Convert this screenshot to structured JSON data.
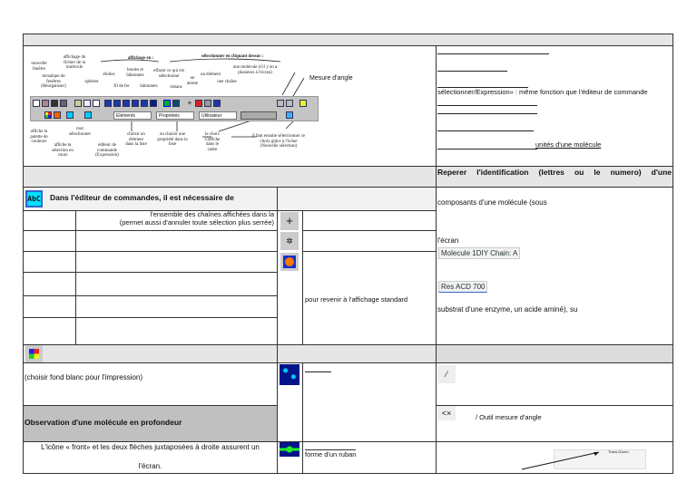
{
  "toolbar_figure": {
    "labels": {
      "nouvelle_fenetre": "nouvelle fenêtre",
      "affichage_fichier": "affichage du fichier de la molécule",
      "mosaique": "mosaïque de fenêtres (Réorganiser)",
      "affichage_en": "affichage en :",
      "spheres": "sphères",
      "stick": "étoiles",
      "fil_de_fer": "fil de fer",
      "boules_batonnets": "boules et bâtonnets",
      "batonnets": "bâtonnets",
      "effacer": "effacer ce qui est sélectionné",
      "rubans": "rubans",
      "selectionner_en_cliquant": "sélectionner en cliquant dessus :",
      "un_atome": "un atome",
      "un_element": "un élément",
      "une_chaine": "une chaîne",
      "une_molecule": "une molécule (s'il y en a plusieurs à l'écran)",
      "mesure_angle": "Mesure d'angle",
      "palette": "affiche la palette de couleurs",
      "selection_en_cours": "affiche la sélection en cours",
      "tout_selectionner": "tout sélectionner",
      "editeur_commande": "éditeur de commande (Expression)",
      "choisir_element": "choisir un élément dans la liste",
      "choisir_propriete": "ou choisir une propriété dans la liste",
      "choix_affiche": "le choix s'affiche dans le cadre",
      "il_faut_ensuite": "il faut ensuite sélectionner ce choix grâce à l'icône (Nouvelle sélection)"
    },
    "dropdowns": [
      "Eléments",
      "Propriétés",
      "Utilisateur"
    ]
  },
  "left": {
    "editor_heading": "Dans l'éditeur de commandes, il est nécessaire de",
    "row1_text_a": "l'ensemble des chaînes affichées dans la",
    "row1_text_b": "(permet aussi d'annuler toute sélection plus serrée)",
    "standard_text": "pour revenir à l'affichage standard",
    "print_text": "(choisir fond blanc pour l'impression)",
    "depth_heading": "Observation d'une molécule en profondeur",
    "front_text_a": "L'icône « front» et les deux flèches juxtaposées à droite assurent un",
    "front_text_b": "l'écran.",
    "ribbon_text": "forme d'un ruban"
  },
  "right": {
    "expression_text": "sélectionner/Expression» : même fonction que l'éditeur de commande",
    "units_text": "unités d'une molécule",
    "reperer_text": "Reperer l'identification (lettres ou le numero) d'une",
    "composants_text": "composants d'une molécule (sous",
    "ecran_text": "l'écran",
    "molecule_chip": "Molecule  1DIY  Chain: A",
    "res_chip": "Res  ACD 700",
    "substrat_text": "substrat d'une enzyme, un acide aminé), su",
    "angle_text": "/ Outil mesure d'angle",
    "mini_panel": "Trans./Zoom"
  },
  "icons": [
    "abc-editor-icon",
    "atom-select-icon",
    "chain-select-icon",
    "reset-view-icon",
    "palette-icon",
    "spacefill-icon",
    "ribbon-icon",
    "distance-icon",
    "angle-icon"
  ],
  "colors": {
    "header_gray": "#e6e6e6",
    "section_gray": "#c0c0c0",
    "icon_blue": "#1a3aa8",
    "icon_cyan": "#00e0ff"
  }
}
